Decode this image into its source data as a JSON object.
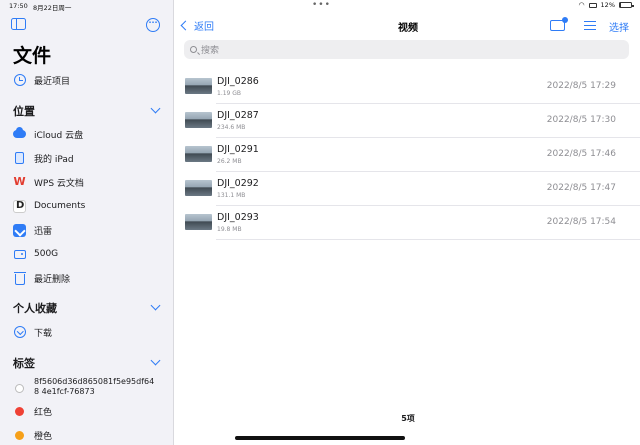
{
  "status": {
    "time": "17:50",
    "date": "8月22日周一",
    "battery": "12%"
  },
  "sidebar": {
    "title": "文件",
    "recents": {
      "label": "最近项目",
      "icon": "clock-icon"
    },
    "locations": {
      "header": "位置",
      "items": [
        {
          "label": "iCloud 云盘",
          "icon": "icloud-icon"
        },
        {
          "label": "我的 iPad",
          "icon": "ipad-icon"
        },
        {
          "label": "WPS 云文档",
          "icon": "wps-icon"
        },
        {
          "label": "Documents",
          "icon": "documents-app-icon"
        },
        {
          "label": "迅雷",
          "icon": "xunlei-icon"
        },
        {
          "label": "500G",
          "icon": "external-drive-icon"
        },
        {
          "label": "最近删除",
          "icon": "trash-icon"
        }
      ]
    },
    "favorites": {
      "header": "个人收藏",
      "items": [
        {
          "label": "下载",
          "icon": "download-icon"
        }
      ]
    },
    "tags": {
      "header": "标签",
      "items": [
        {
          "label": "8f5606d36d865081f5e95df648 4e1fcf-76873",
          "color": "#ffffff"
        },
        {
          "label": "红色",
          "color": "#ef4135"
        },
        {
          "label": "橙色",
          "color": "#f6a019"
        }
      ]
    }
  },
  "topbar": {
    "back_label": "返回",
    "title": "视频",
    "select_label": "选择"
  },
  "search": {
    "placeholder": "搜索"
  },
  "files": [
    {
      "name": "DJI_0286",
      "size": "1.19 GB",
      "date": "2022/8/5 17:29"
    },
    {
      "name": "DJI_0287",
      "size": "234.6 MB",
      "date": "2022/8/5 17:30"
    },
    {
      "name": "DJI_0291",
      "size": "26.2 MB",
      "date": "2022/8/5 17:46"
    },
    {
      "name": "DJI_0292",
      "size": "131.1 MB",
      "date": "2022/8/5 17:47"
    },
    {
      "name": "DJI_0293",
      "size": "19.8 MB",
      "date": "2022/8/5 17:54"
    }
  ],
  "footer": {
    "count": "5项"
  },
  "colors": {
    "accent": "#2f7cf6",
    "sidebar_bg": "#f2f2f7"
  }
}
